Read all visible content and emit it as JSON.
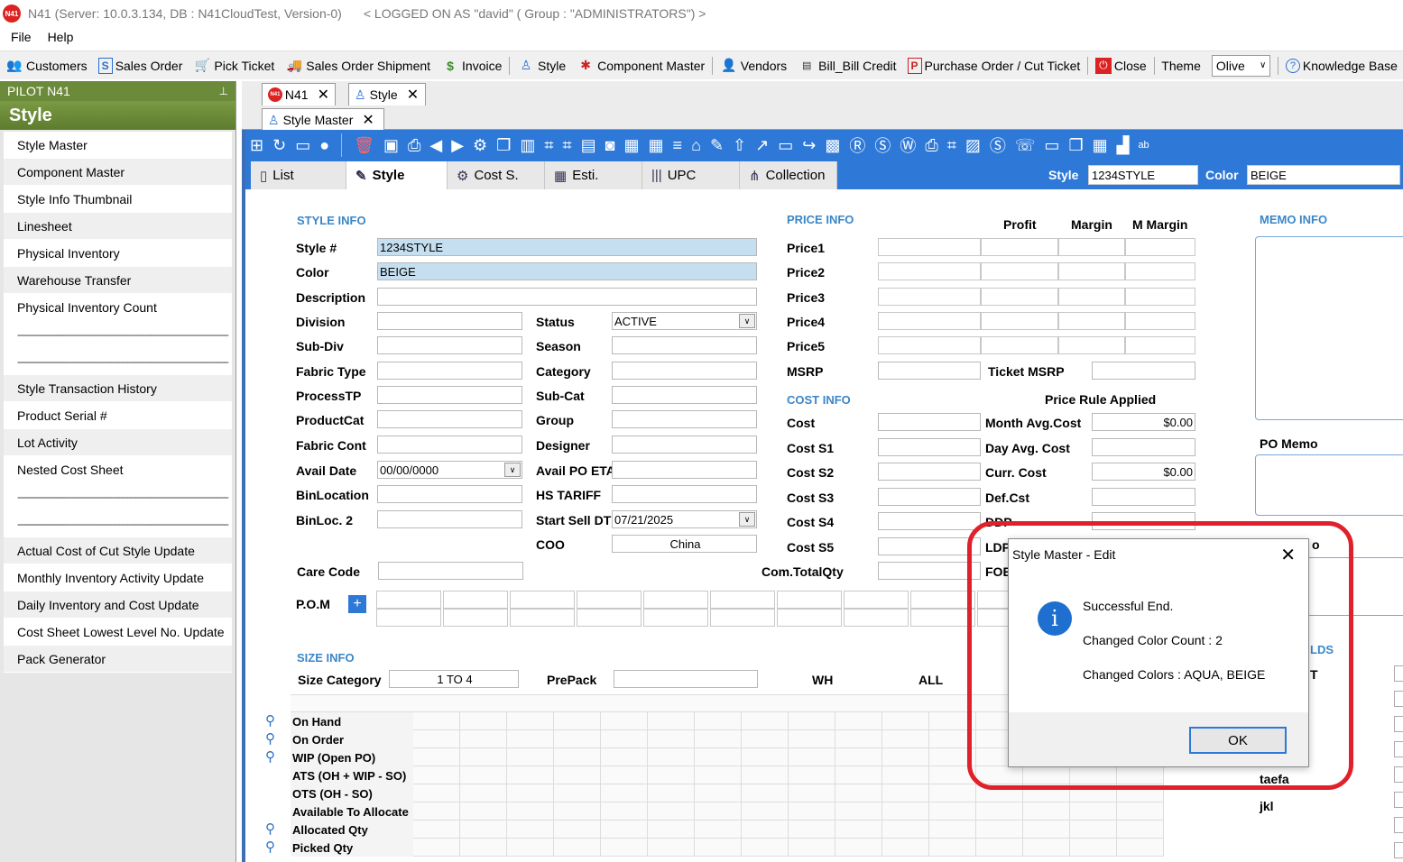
{
  "window": {
    "title": "N41  (Server: 10.0.3.134, DB : N41CloudTest, Version-0)",
    "logon": "< LOGGED ON AS \"david\" ( Group : \"ADMINISTRATORS\") >",
    "logo": "N41"
  },
  "menu": [
    "File",
    "Help"
  ],
  "toolbar": {
    "items": [
      {
        "label": "Customers",
        "icon": "people-icon"
      },
      {
        "label": "Sales Order",
        "icon": "s-document-icon"
      },
      {
        "label": "Pick Ticket",
        "icon": "cart-icon"
      },
      {
        "label": "Sales Order Shipment",
        "icon": "truck-icon"
      },
      {
        "label": "Invoice",
        "icon": "dollar-icon"
      },
      {
        "label": "Style",
        "icon": "dress-icon"
      },
      {
        "label": "Component Master",
        "icon": "component-icon"
      },
      {
        "label": "Vendors",
        "icon": "vendor-icon"
      },
      {
        "label": "Bill_Bill Credit",
        "icon": "bill-icon"
      },
      {
        "label": "Purchase Order / Cut Ticket",
        "icon": "p-document-icon"
      },
      {
        "label": "Close",
        "icon": "power-icon"
      }
    ],
    "theme_label": "Theme",
    "theme_value": "Olive",
    "knowledge_base": "Knowledge Base"
  },
  "left_pane": {
    "header": "PILOT  N41",
    "title": "Style",
    "items": [
      "Style Master",
      "Component Master",
      "Style Info Thumbnail",
      "Linesheet",
      "Physical Inventory",
      "Warehouse Transfer",
      "Physical Inventory Count",
      "------------------------------------------------------------------------------",
      "------------------------------------------------------------------------------",
      "Style Transaction History",
      "Product Serial #",
      "Lot Activity",
      "Nested Cost Sheet",
      "------------------------------------------------------------------------------",
      "------------------------------------------------------------------------------",
      "Actual Cost of Cut Style Update",
      "Monthly Inventory Activity Update",
      "Daily Inventory and Cost Update",
      "Cost Sheet Lowest Level No. Update",
      "Pack Generator"
    ]
  },
  "doc_tabs": [
    {
      "label": "N41"
    },
    {
      "label": "Style"
    }
  ],
  "sub_tabs": [
    {
      "label": "Style Master"
    }
  ],
  "section_tabs": [
    {
      "label": "List"
    },
    {
      "label": "Style"
    },
    {
      "label": "Cost S."
    },
    {
      "label": "Esti."
    },
    {
      "label": "UPC"
    },
    {
      "label": "Collection"
    }
  ],
  "header_fields": {
    "style_label": "Style",
    "style_value": "1234STYLE",
    "color_label": "Color",
    "color_value": "BEIGE"
  },
  "style_info": {
    "section": "STYLE INFO",
    "style_no_label": "Style #",
    "style_no": "1234STYLE",
    "color_label": "Color",
    "color": "BEIGE",
    "description_label": "Description",
    "division_label": "Division",
    "status_label": "Status",
    "status": "ACTIVE",
    "subdiv_label": "Sub-Div",
    "season_label": "Season",
    "fabric_type_label": "Fabric Type",
    "category_label": "Category",
    "processtp_label": "ProcessTP",
    "subcat_label": "Sub-Cat",
    "productcat_label": "ProductCat",
    "group_label": "Group",
    "fabric_cont_label": "Fabric Cont",
    "designer_label": "Designer",
    "avail_date_label": "Avail Date",
    "avail_date": "00/00/0000",
    "avail_po_eta_label": "Avail PO ETA",
    "binlocation_label": "BinLocation",
    "hs_tariff_label": "HS TARIFF",
    "binloc2_label": "BinLoc. 2",
    "start_sell_label": "Start Sell DT",
    "start_sell": "07/21/2025",
    "coo_label": "COO",
    "coo": "China",
    "care_code_label": "Care Code",
    "pom_label": "P.O.M"
  },
  "price_info": {
    "section": "PRICE INFO",
    "profit": "Profit",
    "margin": "Margin",
    "m_margin": "M Margin",
    "price_labels": [
      "Price1",
      "Price2",
      "Price3",
      "Price4",
      "Price5"
    ],
    "msrp": "MSRP",
    "ticket_msrp": "Ticket MSRP",
    "cost_section": "COST INFO",
    "price_rule": "Price Rule Applied",
    "cost": "Cost",
    "month_avg_cost": "Month Avg.Cost",
    "month_avg_value": "$0.00",
    "cost_s1": "Cost S1",
    "day_avg_cost": "Day Avg. Cost",
    "cost_s2": "Cost S2",
    "curr_cost": "Curr. Cost",
    "curr_cost_value": "$0.00",
    "cost_s3": "Cost S3",
    "def_cst": "Def.Cst",
    "cost_s4": "Cost S4",
    "ddp": "DDP",
    "cost_s5": "Cost S5",
    "ldp": "LDP",
    "com_total_qty": "Com.TotalQty",
    "fob": "FOB"
  },
  "memo_info": {
    "section": "MEMO INFO",
    "po_memo": "PO Memo",
    "cut_o": "o",
    "lds": "LDS",
    "t_frag": "T",
    "row1": "taefa",
    "row2": "jkl"
  },
  "size_info": {
    "section": "SIZE INFO",
    "size_category_label": "Size Category",
    "size_category": "1 TO 4",
    "prepack_label": "PrePack",
    "wh_label": "WH",
    "all_label": "ALL",
    "rows": [
      "On Hand",
      "On Order",
      "WIP (Open PO)",
      "ATS (OH + WIP - SO)",
      "OTS (OH - SO)",
      "Available To Allocate",
      "Allocated Qty",
      "Picked Qty"
    ]
  },
  "dialog": {
    "title": "Style Master - Edit",
    "line1": "Successful End.",
    "line2": "Changed Color Count : 2",
    "line3": "Changed Colors : AQUA, BEIGE",
    "ok": "OK"
  },
  "colors": {
    "accent": "#2e79d8",
    "olive": "#6b8a3a",
    "highlight": "#e0202a"
  }
}
